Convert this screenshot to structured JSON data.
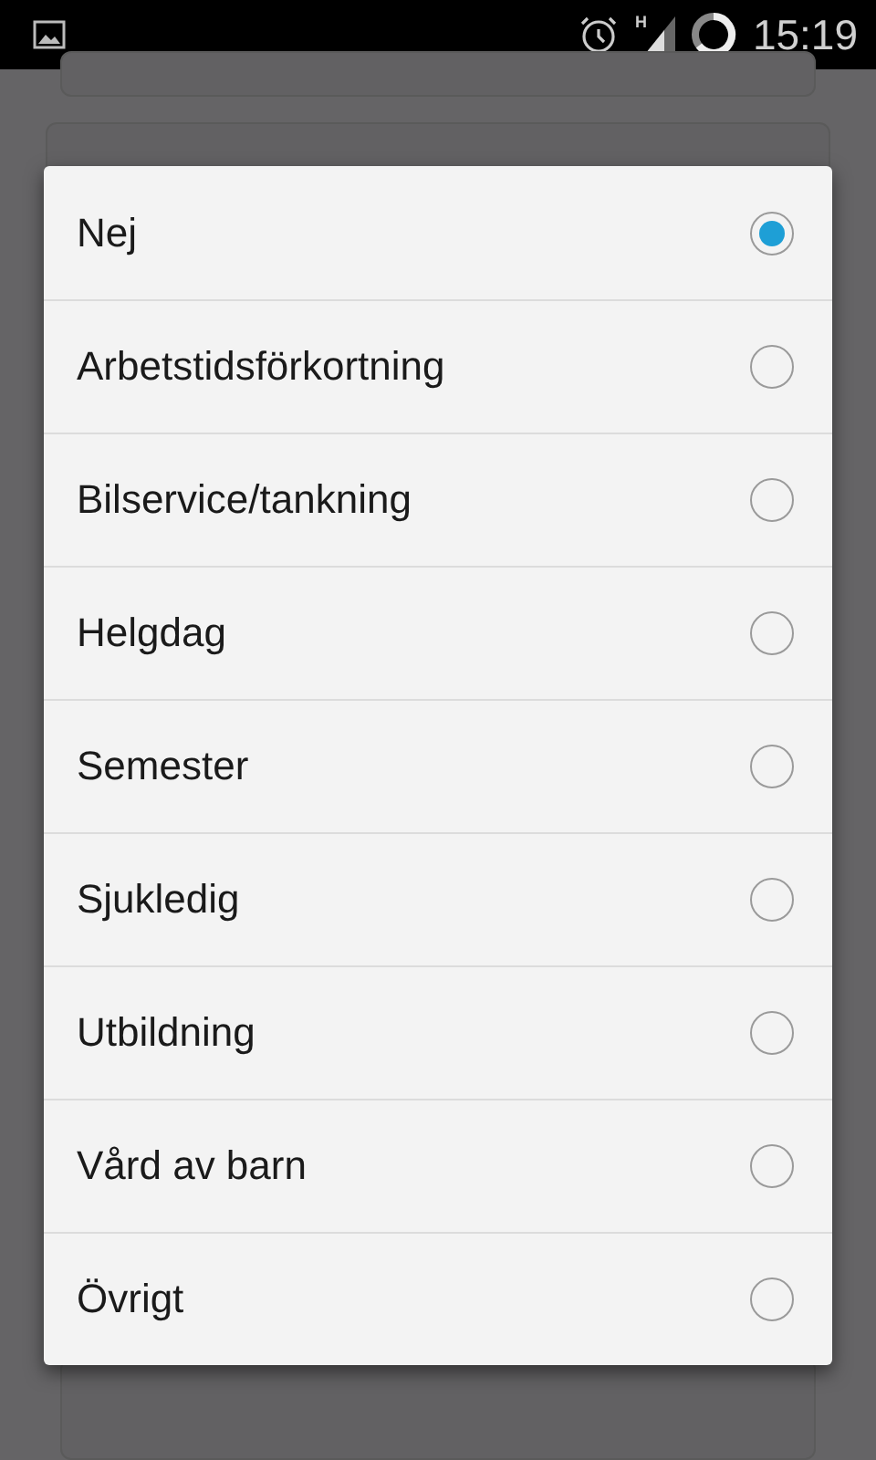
{
  "status_bar": {
    "time": "15:19",
    "network": "H"
  },
  "dialog": {
    "options": [
      {
        "label": "Nej",
        "selected": true
      },
      {
        "label": "Arbetstidsförkortning",
        "selected": false
      },
      {
        "label": "Bilservice/tankning",
        "selected": false
      },
      {
        "label": "Helgdag",
        "selected": false
      },
      {
        "label": "Semester",
        "selected": false
      },
      {
        "label": "Sjukledig",
        "selected": false
      },
      {
        "label": "Utbildning",
        "selected": false
      },
      {
        "label": "Vård av barn",
        "selected": false
      },
      {
        "label": "Övrigt",
        "selected": false
      }
    ]
  }
}
